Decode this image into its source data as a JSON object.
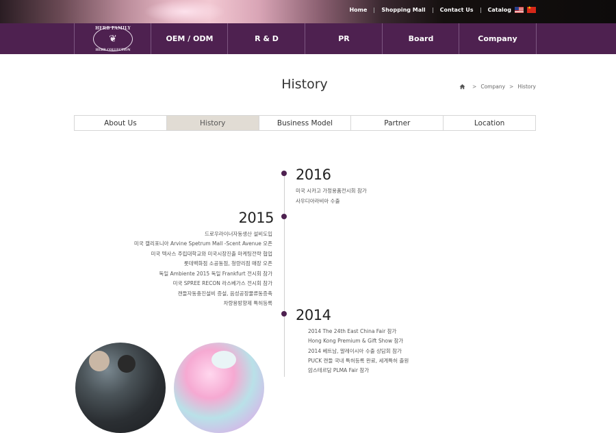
{
  "topbar": {
    "links": [
      "Home",
      "Shopping Mall",
      "Contact Us",
      "Catalog"
    ],
    "flags": [
      "us-flag-icon",
      "china-flag-icon"
    ]
  },
  "logo": {
    "top_text": "HERB FAMILY",
    "bottom_text": "HERB COLLECTION"
  },
  "nav": {
    "items": [
      "OEM / ODM",
      "R & D",
      "PR",
      "Board",
      "Company"
    ]
  },
  "page": {
    "title": "History",
    "breadcrumb": [
      "Company",
      "History"
    ]
  },
  "subtabs": {
    "items": [
      "About Us",
      "History",
      "Business Model",
      "Partner",
      "Location"
    ],
    "active": "History"
  },
  "timeline": [
    {
      "year": "2016",
      "items": [
        "미국 시카고 가정용품전시회 참가",
        "사우디아라비아 수출"
      ]
    },
    {
      "year": "2015",
      "items": [
        "드로우라이너자동생산 설비도입",
        "미국 캘리포니아 Arvine Spetrum Mall -Scent Avenue 오픈",
        "미국 텍사스 주립대학교와 미국시장진출 마케팅전략 협업",
        "롯데백화점 소공동점, 청량리점 매장 오픈",
        "독일 Ambiente 2015 독일 Frankfurt 전시회 참가",
        "미국 SPREE RECON 라스베가스 전시회 참가",
        "캔들자동충진설비 증설, 음성공장물류동증축",
        "차량용방향제 특허등록"
      ]
    },
    {
      "year": "2014",
      "items": [
        "2014 The 24th East China Fair 참가",
        "Hong Kong Premium & Gift Show 참가",
        "2014 베트남, 말레이시아 수출 상담회 참가",
        "PUCK 캔들 국내 특허등록 완료, 세계특허 출원",
        "암스테르담 PLMA Fair 참가"
      ]
    }
  ],
  "colors": {
    "nav_bg": "#4e2150",
    "accent": "#4e2150",
    "active_tab": "#e1dcd4"
  }
}
